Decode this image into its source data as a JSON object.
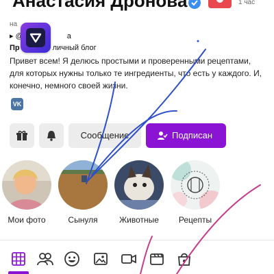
{
  "profile": {
    "name": "Анастасия Дронова",
    "time": "1 час",
    "line_small": "на",
    "username": "▸ @",
    "username_tail": "а",
    "tagline_prefix": "Пр",
    "tagline_rest": "личный блог",
    "bio": "Привет всем! Я делюсь простыми и проверенными рецептами, для которых нужны только те ингредиенты, что есть у каждого. И, конечно, немного своей жизни.",
    "vk_label": "VK"
  },
  "actions": {
    "message_label": "Сообщение",
    "subscribe_label": "Подписан"
  },
  "stories": [
    {
      "label": "Мои фото"
    },
    {
      "label": "Сынуля"
    },
    {
      "label": "Животные"
    },
    {
      "label": "Рецепты"
    }
  ],
  "tabs": [
    {
      "icon": "grid-icon"
    },
    {
      "icon": "people-icon"
    },
    {
      "icon": "face-icon"
    },
    {
      "icon": "image-icon"
    },
    {
      "icon": "video-icon"
    },
    {
      "icon": "clapper-icon"
    },
    {
      "icon": "shop-icon"
    }
  ],
  "colors": {
    "accent": "#8b14d4",
    "button_bg": "#ececec",
    "scribble_blue": "#2d4fc9",
    "scribble_pink": "#c43b8a"
  }
}
